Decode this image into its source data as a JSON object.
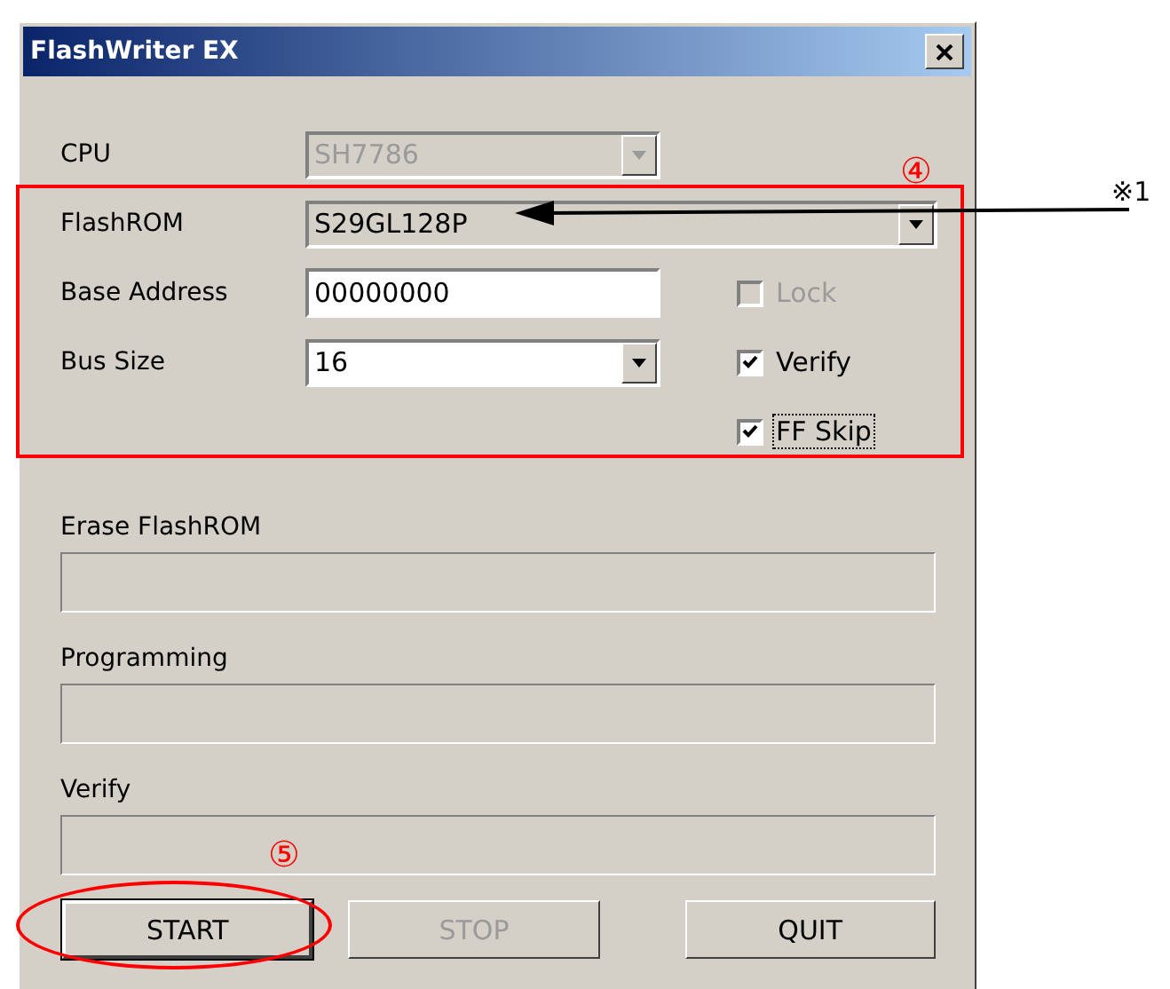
{
  "window": {
    "title": "FlashWriter EX"
  },
  "selectors": [
    {
      "kind": "combo",
      "label": "CPU",
      "value": "SH7786",
      "disabled": true,
      "wide": false
    },
    {
      "kind": "combo",
      "label": "FlashROM",
      "value": "S29GL128P",
      "disabled": false,
      "wide": true
    },
    {
      "kind": "input",
      "label": "Base Address",
      "value": "00000000"
    },
    {
      "kind": "combo",
      "label": "Bus Size",
      "value": "16",
      "disabled": false,
      "wide": false
    }
  ],
  "checkboxes": [
    {
      "label": "Lock",
      "checked": false,
      "disabled": true,
      "focused": false
    },
    {
      "label": "Verify",
      "checked": true,
      "disabled": false,
      "focused": false
    },
    {
      "label": "FF Skip",
      "checked": true,
      "disabled": false,
      "focused": true
    }
  ],
  "progress": [
    {
      "label": "Erase FlashROM",
      "level": 0
    },
    {
      "label": "Programming",
      "level": 0
    },
    {
      "label": "Verify",
      "level": 0
    }
  ],
  "buttons": [
    {
      "label": "START",
      "disabled": false,
      "default": true
    },
    {
      "label": "STOP",
      "disabled": true,
      "default": false
    },
    {
      "label": "QUIT",
      "disabled": false,
      "default": false
    }
  ],
  "annotations": {
    "settings_marker": "④",
    "start_marker": "⑤",
    "note_marker": "※1"
  }
}
